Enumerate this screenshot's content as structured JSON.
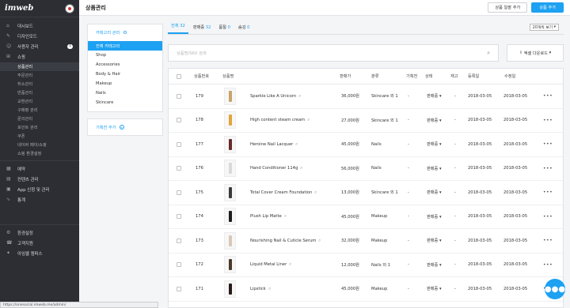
{
  "app": {
    "logo": "imweb"
  },
  "sidebar": {
    "items": [
      {
        "icon": "home-icon",
        "label": "대시보드"
      },
      {
        "icon": "design-icon",
        "label": "디자인모드"
      },
      {
        "icon": "users-icon",
        "label": "사용자 관리",
        "badge": "1"
      },
      {
        "icon": "cart-icon",
        "label": "쇼핑"
      }
    ],
    "shopping_sub": [
      "상품관리",
      "주문관리",
      "취소관리",
      "반품관리",
      "교환관리",
      "구매평 관리",
      "문의관리",
      "포인트 관리",
      "쿠폰",
      "네이버 페이/쇼핑",
      "쇼핑 환경설정"
    ],
    "items2": [
      {
        "icon": "calendar-icon",
        "label": "예약"
      },
      {
        "icon": "content-icon",
        "label": "컨텐츠 관리"
      },
      {
        "icon": "apps-icon",
        "label": "App 신청 및 관리"
      },
      {
        "icon": "chart-icon",
        "label": "통계"
      }
    ],
    "bottom": [
      {
        "icon": "settings-icon",
        "label": "환경설정"
      },
      {
        "icon": "support-icon",
        "label": "고객지원"
      },
      {
        "icon": "campus-icon",
        "label": "아임웹 캠퍼스"
      }
    ],
    "status_url": "https://onesocial.imweb.me/admin/"
  },
  "header": {
    "title": "상품관리",
    "bulk_add_label": "상품 일괄 추가",
    "add_label": "상품 추가"
  },
  "categories": {
    "header": "카테고리 관리",
    "items": [
      "전체 카테고리",
      "Shop",
      "Accessories",
      "Body & Hair",
      "Makeup",
      "Nails",
      "Skincare"
    ],
    "selected_index": 0,
    "add_label": "기획전 추가"
  },
  "tabs": [
    {
      "label": "전체",
      "count": "32"
    },
    {
      "label": "판매중",
      "count": "32"
    },
    {
      "label": "품절",
      "count": "0"
    },
    {
      "label": "숨김",
      "count": "0"
    }
  ],
  "per_page": "20개씩 보기",
  "search": {
    "placeholder": "상품명/SKU 검색"
  },
  "excel_label": "엑셀 다운로드",
  "table": {
    "columns": [
      "상품번호",
      "상품명",
      "판매가",
      "분류",
      "기획전",
      "상태",
      "재고",
      "등록일",
      "수정일"
    ],
    "rows": [
      {
        "no": "179",
        "name": "Sparkle Like A Unicorn",
        "price": "36,000원",
        "category": "Skincare 외 1",
        "promo": "-",
        "status": "판매중",
        "stock": "-",
        "reg": "2018-03-05",
        "mod": "2018-03-05",
        "thumb_color": "#c8a46a"
      },
      {
        "no": "178",
        "name": "High content steam cream",
        "price": "27,000원",
        "category": "Skincare 외 1",
        "promo": "-",
        "status": "판매중",
        "stock": "-",
        "reg": "2018-03-05",
        "mod": "2018-03-05",
        "thumb_color": "#e2a43a"
      },
      {
        "no": "177",
        "name": "Heroine Nail Lacquer",
        "price": "45,000원",
        "category": "Nails",
        "promo": "-",
        "status": "판매중",
        "stock": "-",
        "reg": "2018-03-05",
        "mod": "2018-03-05",
        "thumb_color": "#6a2a2a"
      },
      {
        "no": "176",
        "name": "Hand Conditioner 114g",
        "price": "56,000원",
        "category": "Nails",
        "promo": "-",
        "status": "판매중",
        "stock": "-",
        "reg": "2018-03-05",
        "mod": "2018-03-05",
        "thumb_color": "#d9d9d9"
      },
      {
        "no": "175",
        "name": "Total Cover Cream Foundation",
        "price": "13,000원",
        "category": "Skincare 외 1",
        "promo": "-",
        "status": "판매중",
        "stock": "-",
        "reg": "2018-03-05",
        "mod": "2018-03-05",
        "thumb_color": "#3a3a3a"
      },
      {
        "no": "174",
        "name": "Plush Lip Matte",
        "price": "45,000원",
        "category": "Makeup",
        "promo": "-",
        "status": "판매중",
        "stock": "-",
        "reg": "2018-03-05",
        "mod": "2018-03-05",
        "thumb_color": "#1e1e1e"
      },
      {
        "no": "173",
        "name": "Nourishing Nail & Cuticle Serum",
        "price": "32,000원",
        "category": "Makeup",
        "promo": "-",
        "status": "판매중",
        "stock": "-",
        "reg": "2018-03-05",
        "mod": "2018-03-05",
        "thumb_color": "#d8c8b8"
      },
      {
        "no": "172",
        "name": "Liquid Metal Liner",
        "price": "12,000원",
        "category": "Nails 외 1",
        "promo": "-",
        "status": "판매중",
        "stock": "-",
        "reg": "2018-03-05",
        "mod": "2018-03-05",
        "thumb_color": "#4a3a2a"
      },
      {
        "no": "171",
        "name": "Lipstick",
        "price": "45,000원",
        "category": "Makeup",
        "promo": "-",
        "status": "판매중",
        "stock": "-",
        "reg": "2018-03-05",
        "mod": "2018-03-05",
        "thumb_color": "#2a1a1a"
      }
    ]
  },
  "colors": {
    "accent": "#1da1f2",
    "sidebar_bg": "#2c2e33"
  }
}
